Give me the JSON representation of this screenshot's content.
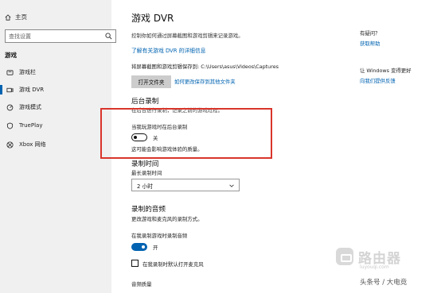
{
  "sidebar": {
    "home_label": "主页",
    "search_placeholder": "查找设置",
    "section_label": "游戏",
    "items": [
      {
        "label": "游戏栏",
        "icon": "game-bar-icon"
      },
      {
        "label": "游戏 DVR",
        "icon": "game-dvr-icon",
        "active": true
      },
      {
        "label": "游戏模式",
        "icon": "game-mode-icon"
      },
      {
        "label": "TruePlay",
        "icon": "trueplay-icon"
      },
      {
        "label": "Xbox 网络",
        "icon": "xbox-icon"
      }
    ]
  },
  "main": {
    "title": "游戏 DVR",
    "description": "控制你如何通过屏幕截图和游戏剪辑来记录游戏。",
    "learn_more_link": "了解有关游戏 DVR 的详细信息",
    "save_path_text": "将屏幕截图和游戏剪辑保存到: C:\\Users\\asus\\Videos\\Captures",
    "open_folder_button": "打开文件夹",
    "change_location_link": "如何更改保存到其他文件夹",
    "background_recording": {
      "heading": "后台录制",
      "sub": "在后台进行录制，记录之前的游戏过程。",
      "toggle_label": "当我玩游戏时在后台录制",
      "toggle_state_text": "关",
      "toggle_on": false,
      "note": "这可能会影响游戏体验的质量。"
    },
    "recording_time": {
      "heading": "录制时间",
      "max_label": "最长录制时间",
      "selected": "2 小时"
    },
    "recorded_audio": {
      "heading": "录制的音频",
      "sub": "更改游戏和麦克风的录制方式。",
      "toggle_label": "在我录制游戏时录制音频",
      "toggle_state_text": "开",
      "toggle_on": true,
      "mic_checkbox_label": "在我录制时默认打开麦克风",
      "audio_quality_label": "音频质量"
    }
  },
  "right_panel": {
    "question": "有疑问？",
    "get_help_link": "获取帮助",
    "improve_text": "让 Windows 变得更好",
    "feedback_link": "向我们提供反馈"
  },
  "watermark": {
    "brand": "路由器",
    "url": "luyouqi.com",
    "credit": "头条号 / 大电竞"
  },
  "colors": {
    "accent": "#0063b1",
    "annotation": "#d9352b"
  }
}
